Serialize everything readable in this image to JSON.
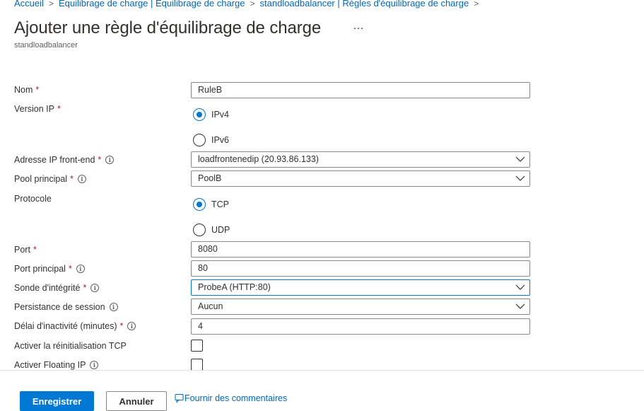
{
  "breadcrumb": [
    {
      "label": "Accueil"
    },
    {
      "label": "Équilibrage de charge | Équilibrage de charge"
    },
    {
      "label": "standloadbalancer | Règles d'équilibrage de charge"
    }
  ],
  "header": {
    "title": "Ajouter une règle d'équilibrage de charge",
    "more": "…",
    "subtitle": "standloadbalancer"
  },
  "form": {
    "name": {
      "label": "Nom",
      "value": "RuleB"
    },
    "ip_version": {
      "label": "Version IP",
      "options": [
        "IPv4",
        "IPv6"
      ],
      "selected": "IPv4"
    },
    "frontend_ip": {
      "label": "Adresse IP front-end",
      "value": "loadfrontenedip (20.93.86.133)"
    },
    "backend_pool": {
      "label": "Pool principal",
      "value": "PoolB"
    },
    "protocol": {
      "label": "Protocole",
      "options": [
        "TCP",
        "UDP"
      ],
      "selected": "TCP"
    },
    "port": {
      "label": "Port",
      "value": "8080"
    },
    "backend_port": {
      "label": "Port principal",
      "value": "80"
    },
    "health_probe": {
      "label": "Sonde d'intégrité",
      "value": "ProbeA (HTTP:80)"
    },
    "session_persistence": {
      "label": "Persistance de session",
      "value": "Aucun"
    },
    "idle_timeout": {
      "label": "Délai d'inactivité (minutes)",
      "value": "4"
    },
    "tcp_reset": {
      "label": "Activer la réinitialisation TCP",
      "checked": false
    },
    "floating_ip": {
      "label": "Activer Floating IP",
      "checked": false
    },
    "required_marker": "*",
    "info_glyph": "i"
  },
  "footer": {
    "save_label": "Enregistrer",
    "cancel_label": "Annuler",
    "feedback_label": "Fournir des commentaires"
  },
  "colors": {
    "accent": "#0078d4",
    "link": "#0067b8",
    "required": "#a4262c",
    "text": "#323130"
  },
  "icons": [
    "chevron-right-icon",
    "more-icon",
    "info-icon",
    "chevron-down-icon",
    "feedback-icon"
  ]
}
